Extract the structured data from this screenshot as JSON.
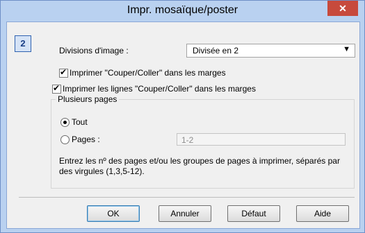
{
  "window": {
    "title": "Impr. mosaïque/poster",
    "close_symbol": "✕"
  },
  "page_icon": {
    "label": "2"
  },
  "divisions": {
    "label": "Divisions d'image :",
    "selected": "Divisée en 2"
  },
  "checkboxes": [
    {
      "label": "Imprimer \"Couper/Coller\" dans les marges",
      "checked": true
    },
    {
      "label": "Imprimer les lignes \"Couper/Coller\" dans les marges",
      "checked": true
    }
  ],
  "pages_group": {
    "title": "Plusieurs pages",
    "all_label": "Tout",
    "pages_label": "Pages :",
    "pages_value": "1-2",
    "info": "Entrez les nº des pages et/ou les groupes de pages à imprimer, séparés par des virgules (1,3,5-12)."
  },
  "buttons": {
    "ok": "OK",
    "cancel": "Annuler",
    "defaults": "Défaut",
    "help": "Aide"
  }
}
